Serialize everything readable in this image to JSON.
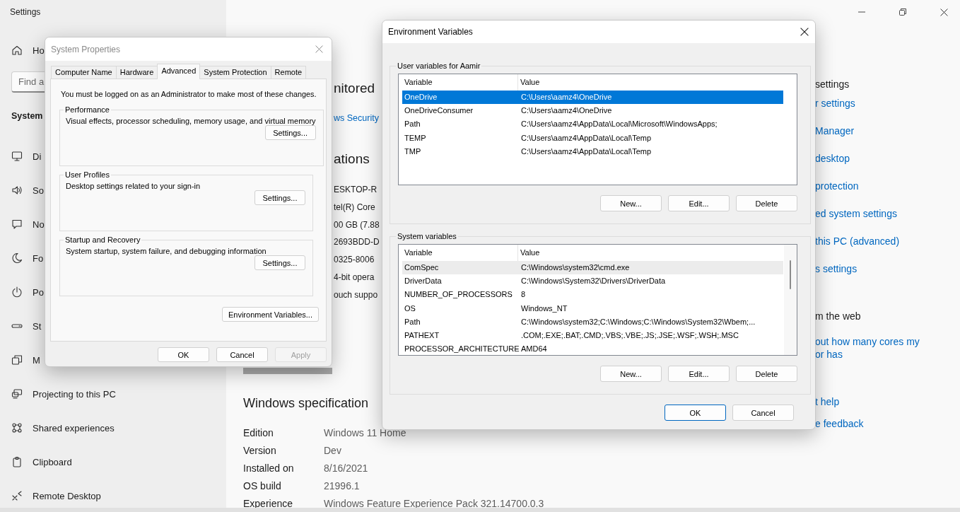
{
  "settings_window": {
    "title": "Settings",
    "home": {
      "kind": "home",
      "label": "Ho"
    },
    "search": {
      "placeholder": "Find a"
    },
    "section": "System",
    "nav_items": [
      {
        "kind": "display",
        "label": "Di"
      },
      {
        "kind": "sound",
        "label": "So"
      },
      {
        "kind": "notifications",
        "label": "No"
      },
      {
        "kind": "focus",
        "label": "Fo"
      },
      {
        "kind": "power",
        "label": "Po"
      },
      {
        "kind": "storage",
        "label": "St"
      },
      {
        "kind": "multitasking",
        "label": "M"
      },
      {
        "kind": "projecting",
        "label": "Projecting to this PC"
      },
      {
        "kind": "shared",
        "label": "Shared experiences"
      },
      {
        "kind": "clipboard",
        "label": "Clipboard"
      },
      {
        "kind": "remote",
        "label": "Remote Desktop"
      }
    ],
    "security_text": "nitored",
    "security_link": "ws Security",
    "specs_heading": "ations",
    "spec_values": [
      "ESKTOP-R",
      "tel(R) Core",
      "00 GB (7.88",
      "2693BDD-D",
      "0325-8006",
      "4-bit opera",
      "ouch suppo"
    ],
    "windows_spec": {
      "heading": "Windows specification",
      "rows": [
        {
          "label": "Edition",
          "value": "Windows 11 Home"
        },
        {
          "label": "Version",
          "value": "Dev"
        },
        {
          "label": "Installed on",
          "value": "8/16/2021"
        },
        {
          "label": "OS build",
          "value": "21996.1"
        },
        {
          "label": "Experience",
          "value": "Windows Feature Experience Pack 321.14700.0.3"
        }
      ]
    },
    "related": {
      "heading": "settings",
      "links": [
        "r settings",
        "Manager",
        "desktop",
        "protection",
        "ed system settings",
        "this PC (advanced)",
        "s settings"
      ]
    },
    "web_help": {
      "heading": "m the web",
      "link_lines": [
        "out how many cores my",
        "or has"
      ]
    },
    "help_links": [
      "t help",
      "e feedback"
    ]
  },
  "system_properties": {
    "title": "System Properties",
    "tabs": [
      {
        "label": "Computer Name",
        "selected": false
      },
      {
        "label": "Hardware",
        "selected": false
      },
      {
        "label": "Advanced",
        "selected": true
      },
      {
        "label": "System Protection",
        "selected": false
      },
      {
        "label": "Remote",
        "selected": false
      }
    ],
    "notice": "You must be logged on as an Administrator to make most of these changes.",
    "groups": [
      {
        "title": "Performance",
        "description": "Visual effects, processor scheduling, memory usage, and virtual memory",
        "button": "Settings..."
      },
      {
        "title": "User Profiles",
        "description": "Desktop settings related to your sign-in",
        "button": "Settings..."
      },
      {
        "title": "Startup and Recovery",
        "description": "System startup, system failure, and debugging information",
        "button": "Settings..."
      }
    ],
    "env_button": "Environment Variables...",
    "buttons": [
      {
        "label": "OK",
        "disabled": false
      },
      {
        "label": "Cancel",
        "disabled": false
      },
      {
        "label": "Apply",
        "disabled": true
      }
    ]
  },
  "environment_variables": {
    "title": "Environment Variables",
    "user_variables": {
      "title": "User variables for Aamir",
      "focused": true,
      "columns": [
        "Variable",
        "Value"
      ],
      "rows": [
        {
          "variable": "OneDrive",
          "value": "C:\\Users\\aamz4\\OneDrive",
          "selected": true
        },
        {
          "variable": "OneDriveConsumer",
          "value": "C:\\Users\\aamz4\\OneDrive",
          "selected": false
        },
        {
          "variable": "Path",
          "value": "C:\\Users\\aamz4\\AppData\\Local\\Microsoft\\WindowsApps;",
          "selected": false
        },
        {
          "variable": "TEMP",
          "value": "C:\\Users\\aamz4\\AppData\\Local\\Temp",
          "selected": false
        },
        {
          "variable": "TMP",
          "value": "C:\\Users\\aamz4\\AppData\\Local\\Temp",
          "selected": false
        }
      ],
      "buttons": [
        "New...",
        "Edit...",
        "Delete"
      ]
    },
    "system_variables": {
      "title": "System variables",
      "focused": false,
      "columns": [
        "Variable",
        "Value"
      ],
      "rows": [
        {
          "variable": "ComSpec",
          "value": "C:\\Windows\\system32\\cmd.exe",
          "selected": true
        },
        {
          "variable": "DriverData",
          "value": "C:\\Windows\\System32\\Drivers\\DriverData",
          "selected": false
        },
        {
          "variable": "NUMBER_OF_PROCESSORS",
          "value": "8",
          "selected": false
        },
        {
          "variable": "OS",
          "value": "Windows_NT",
          "selected": false
        },
        {
          "variable": "Path",
          "value": "C:\\Windows\\system32;C:\\Windows;C:\\Windows\\System32\\Wbem;...",
          "selected": false
        },
        {
          "variable": "PATHEXT",
          "value": ".COM;.EXE;.BAT;.CMD;.VBS;.VBE;.JS;.JSE;.WSF;.WSH;.MSC",
          "selected": false
        },
        {
          "variable": "PROCESSOR_ARCHITECTURE",
          "value": "AMD64",
          "selected": false
        }
      ],
      "buttons": [
        "New...",
        "Edit...",
        "Delete"
      ]
    },
    "buttons": [
      {
        "label": "OK",
        "default": true
      },
      {
        "label": "Cancel",
        "default": false
      }
    ]
  }
}
